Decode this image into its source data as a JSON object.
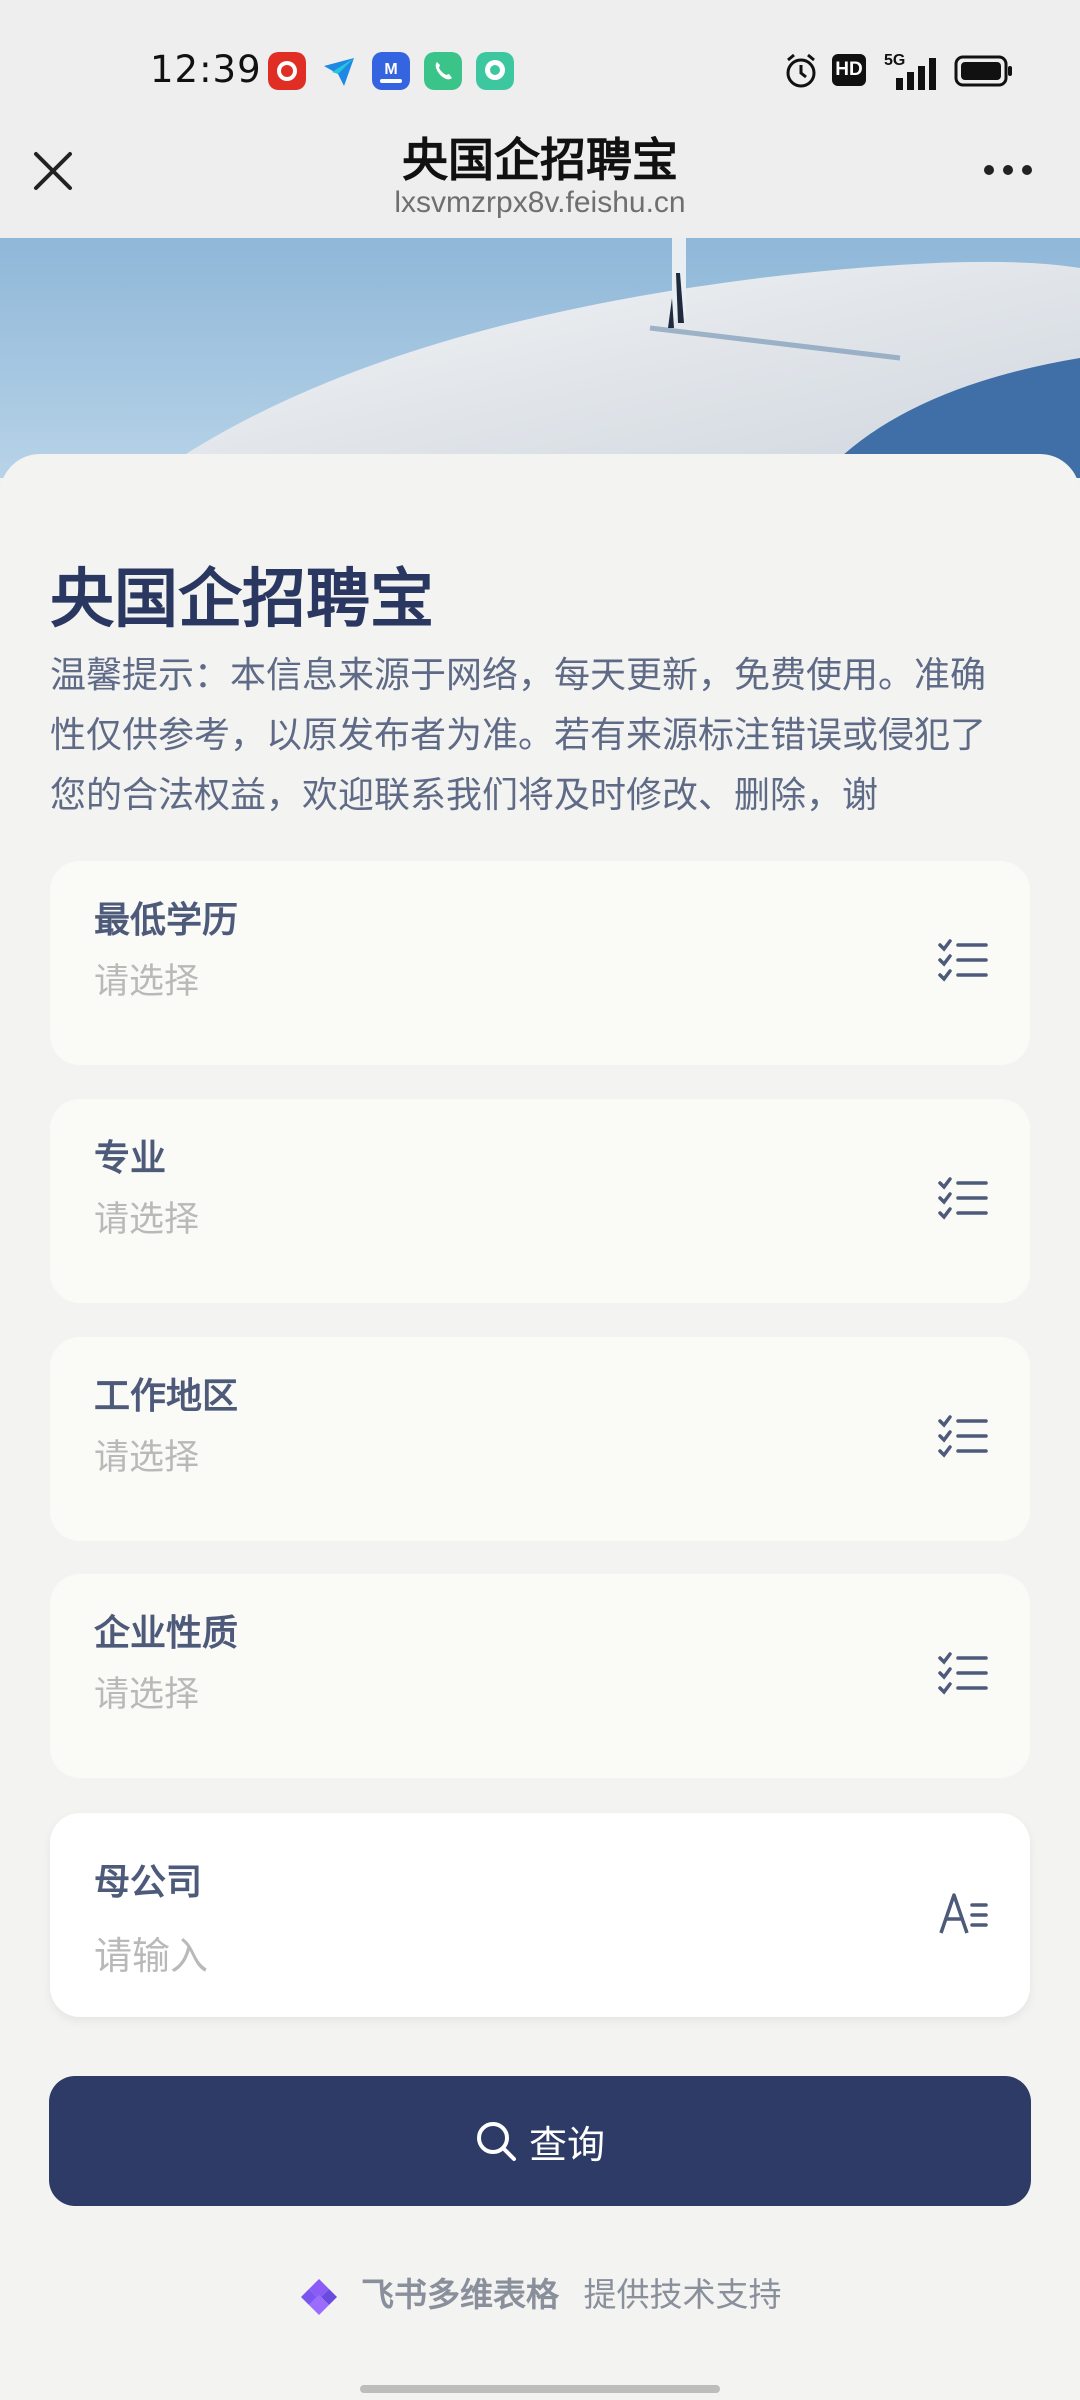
{
  "status_bar": {
    "time": "12:39",
    "app_icons": [
      "pdd-icon",
      "feishu-icon",
      "m-app-icon",
      "phone-icon",
      "chat-icon"
    ],
    "system_icons": [
      "alarm-icon",
      "hd-icon",
      "5g-signal-icon",
      "battery-icon"
    ],
    "hd_text": "HD",
    "network_text": "5G"
  },
  "nav": {
    "title": "央国企招聘宝",
    "url": "lxsvmzrpx8v.feishu.cn"
  },
  "form": {
    "title": "央国企招聘宝",
    "notice": "温馨提示：本信息来源于网络，每天更新，免费使用。准确性仅供参考，以原发布者为准。若有来源标注错误或侵犯了您的合法权益，欢迎联系我们将及时修改、删除，谢",
    "fields": [
      {
        "label": "最低学历",
        "placeholder": "请选择",
        "icon": "list-select-icon"
      },
      {
        "label": "专业",
        "placeholder": "请选择",
        "icon": "list-select-icon"
      },
      {
        "label": "工作地区",
        "placeholder": "请选择",
        "icon": "list-select-icon"
      },
      {
        "label": "企业性质",
        "placeholder": "请选择",
        "icon": "list-select-icon"
      },
      {
        "label": "母公司",
        "placeholder": "请输入",
        "icon": "text-input-icon"
      }
    ],
    "query_label": "查询"
  },
  "footer": {
    "brand": "飞书多维表格",
    "text": "提供技术支持"
  },
  "colors": {
    "primary": "#2d3b66",
    "title": "#2a3760",
    "placeholder": "#b9b9b9"
  }
}
